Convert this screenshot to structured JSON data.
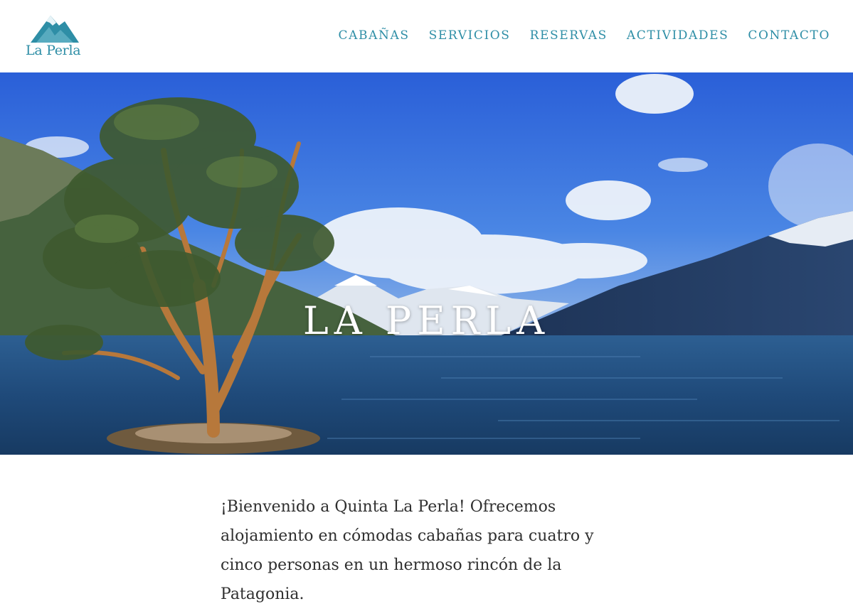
{
  "header": {
    "logo_text": "La Perla",
    "nav": [
      {
        "label": "CABAÑAS"
      },
      {
        "label": "SERVICIOS"
      },
      {
        "label": "RESERVAS"
      },
      {
        "label": "ACTIVIDADES"
      },
      {
        "label": "CONTACTO"
      }
    ]
  },
  "hero": {
    "title": "LA PERLA"
  },
  "intro": {
    "text": "¡Bienvenido a Quinta La Perla! Ofrecemos alojamiento en cómodas cabañas para cuatro y cinco personas en un hermoso rincón de la Patagonia."
  },
  "colors": {
    "accent": "#2e8ea6",
    "text": "#2f2f2f"
  },
  "icons": {
    "logo": "mountain-logo-icon"
  }
}
